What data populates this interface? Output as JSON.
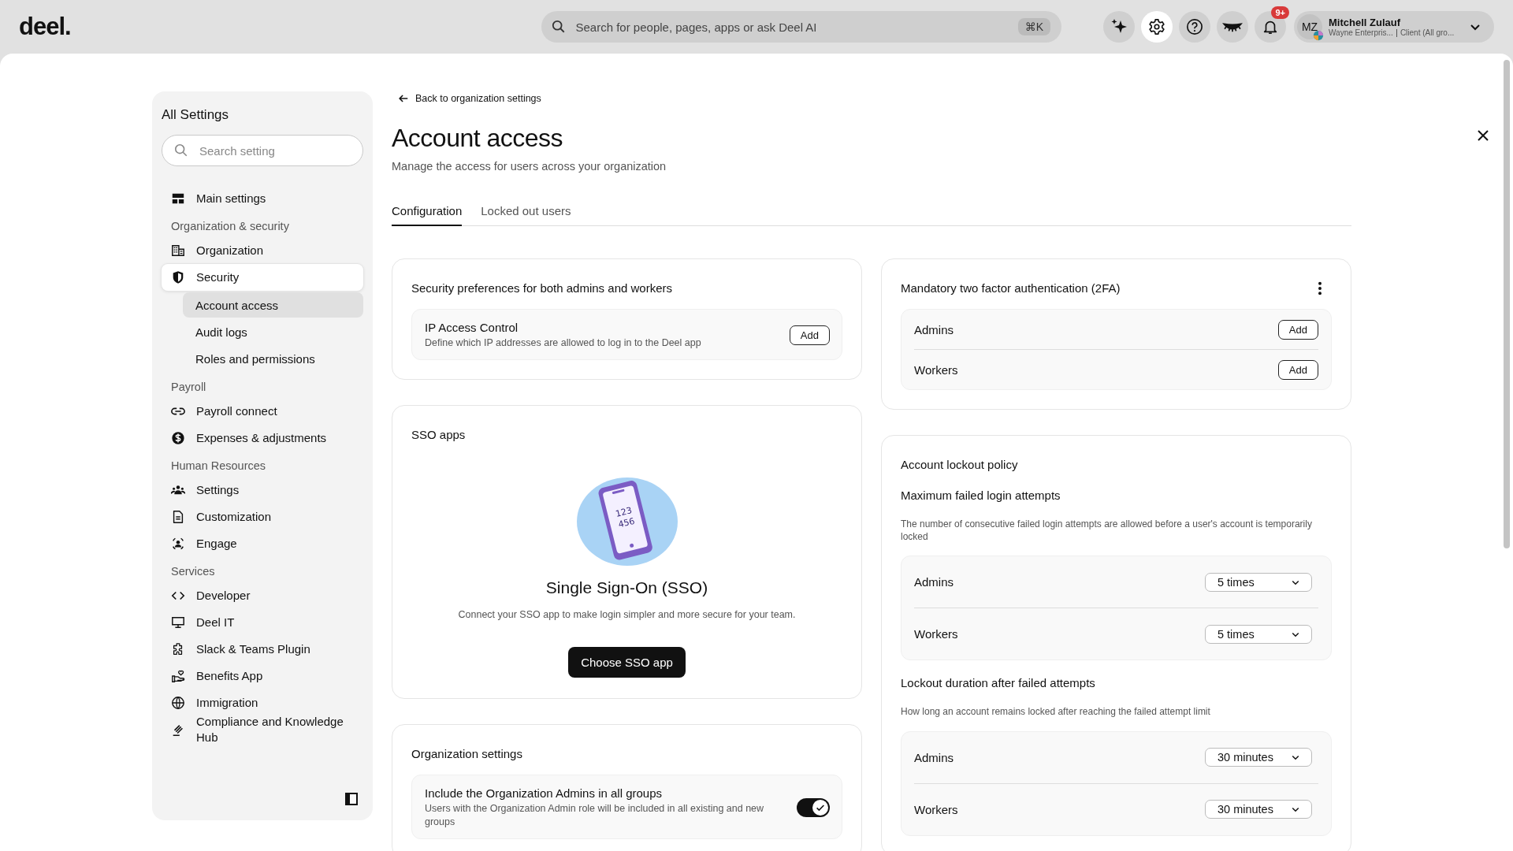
{
  "topbar": {
    "logo": "deel.",
    "search": {
      "placeholder": "Search for people, pages, apps or ask Deel AI",
      "shortcut": "⌘K"
    },
    "toolbar_buttons": [
      {
        "selected": false
      },
      {
        "selected": true
      },
      {
        "selected": false
      },
      {
        "selected": false
      },
      {
        "selected": false,
        "badge": "9+"
      }
    ],
    "profile": {
      "initials": "MZ",
      "name": "Mitchell Zulauf",
      "company": "Wayne Enterpris...",
      "role": "Client (All gro..."
    }
  },
  "sidebar": {
    "title": "All Settings",
    "search": {
      "placeholder": "Search setting"
    },
    "sections": [
      {
        "items": [
          {
            "label": "Main settings",
            "selected": false
          }
        ]
      },
      {
        "heading": "Organization & security",
        "items": [
          {
            "label": "Organization",
            "selected": false
          },
          {
            "label": "Security",
            "selected": true,
            "children": [
              {
                "label": "Account access",
                "selected": true
              },
              {
                "label": "Audit logs",
                "selected": false
              },
              {
                "label": "Roles and permissions",
                "selected": false
              }
            ]
          }
        ]
      },
      {
        "heading": "Payroll",
        "items": [
          {
            "label": "Payroll connect",
            "selected": false
          },
          {
            "label": "Expenses & adjustments",
            "selected": false
          }
        ]
      },
      {
        "heading": "Human Resources",
        "items": [
          {
            "label": "Settings",
            "selected": false
          },
          {
            "label": "Customization",
            "selected": false
          },
          {
            "label": "Engage",
            "selected": false
          }
        ]
      },
      {
        "heading": "Services",
        "items": [
          {
            "label": "Developer",
            "selected": false
          },
          {
            "label": "Deel IT",
            "selected": false
          },
          {
            "label": "Slack & Teams Plugin",
            "selected": false
          },
          {
            "label": "Benefits App",
            "selected": false
          },
          {
            "label": "Immigration",
            "selected": false
          },
          {
            "label": "Compliance and Knowledge Hub",
            "selected": false
          }
        ]
      }
    ]
  },
  "back_link": "Back to organization settings",
  "title": "Account access",
  "subtitle": "Manage the access for users across your organization",
  "tabs": [
    {
      "label": "Configuration",
      "selected": true
    },
    {
      "label": "Locked out users",
      "selected": false
    }
  ],
  "security_preferences": {
    "title": "Security preferences for both admins and workers",
    "item": {
      "title": "IP Access Control",
      "description": "Define which IP addresses are allowed to log in to the Deel app",
      "button": "Add"
    }
  },
  "sso": {
    "title": "SSO apps",
    "illustration_text": [
      "123",
      "456"
    ],
    "heading": "Single Sign-On (SSO)",
    "description": "Connect your SSO app to make login simpler and more secure for your team.",
    "button": "Choose SSO app"
  },
  "organization_settings": {
    "title": "Organization settings",
    "item": {
      "title": "Include the Organization Admins in all groups",
      "description": "Users with the Organization Admin role will be included in all existing and new groups",
      "on": true
    }
  },
  "two_factor": {
    "title": "Mandatory two factor authentication (2FA)",
    "rows": [
      {
        "label": "Admins",
        "button": "Add"
      },
      {
        "label": "Workers",
        "button": "Add"
      }
    ]
  },
  "lockout": {
    "title": "Account lockout policy",
    "groups": [
      {
        "title": "Maximum failed login attempts",
        "description": "The number of consecutive failed login attempts are allowed before a user's account is temporarily locked",
        "rows": [
          {
            "label": "Admins",
            "value": "5 times"
          },
          {
            "label": "Workers",
            "value": "5 times"
          }
        ]
      },
      {
        "title": "Lockout duration after failed attempts",
        "description": "How long an account remains locked after reaching the failed attempt limit",
        "rows": [
          {
            "label": "Admins",
            "value": "30 minutes"
          },
          {
            "label": "Workers",
            "value": "30 minutes"
          }
        ]
      }
    ]
  }
}
